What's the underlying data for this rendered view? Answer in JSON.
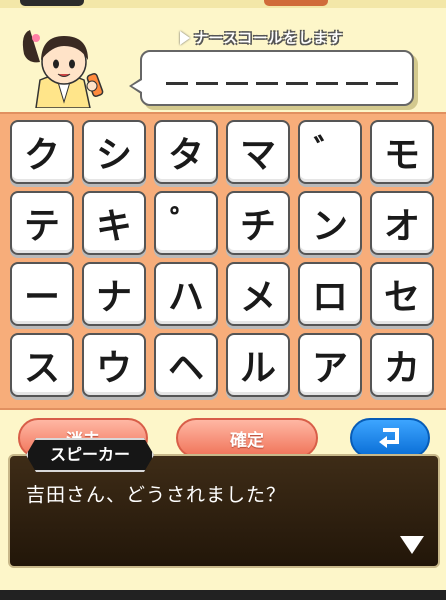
{
  "header": {
    "instruction": "ナースコールをします",
    "answer_slots": 8
  },
  "keyboard": {
    "rows": [
      [
        "ク",
        "シ",
        "タ",
        "マ",
        "゛",
        "モ"
      ],
      [
        "テ",
        "キ",
        "゜",
        "チ",
        "ン",
        "オ"
      ],
      [
        "ー",
        "ナ",
        "ハ",
        "メ",
        "ロ",
        "セ"
      ],
      [
        "ス",
        "ウ",
        "ヘ",
        "ル",
        "ア",
        "カ"
      ]
    ]
  },
  "controls": {
    "delete_label": "消去",
    "confirm_label": "確定",
    "enter_icon": "return-arrow-icon"
  },
  "dialog": {
    "speaker": "スピーカー",
    "message": "吉田さん、どうされました？",
    "next_icon": "next-triangle-icon"
  },
  "colors": {
    "background": "#fdf6c9",
    "board": "#f7ad7a",
    "delete_button": "#f0745a",
    "enter_button": "#0a6ed6",
    "dialog_bg": "#2e200f"
  }
}
